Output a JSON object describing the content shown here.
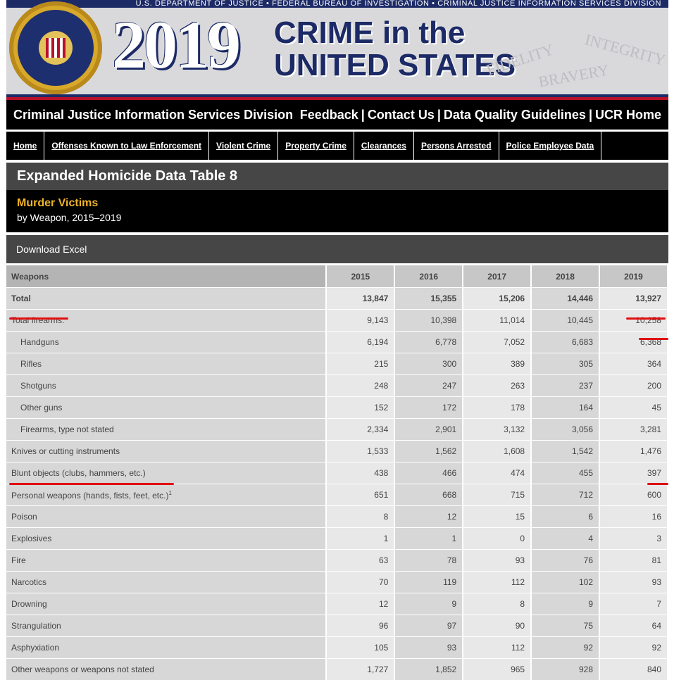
{
  "banner": {
    "top_strip": "U.S. DEPARTMENT OF JUSTICE • FEDERAL BUREAU OF INVESTIGATION • CRIMINAL JUSTICE INFORMATION SERVICES DIVISION",
    "year": "2019",
    "title_line1": "CRIME in the",
    "title_line2": "UNITED STATES",
    "motto": [
      "FIDELITY",
      "BRAVERY",
      "INTEGRITY"
    ]
  },
  "nav_primary": {
    "division": "Criminal Justice Information Services Division",
    "links": [
      "Feedback",
      "Contact Us",
      "Data Quality Guidelines",
      "UCR Home"
    ],
    "separator": "|"
  },
  "nav_secondary": [
    "Home",
    "Offenses Known to Law Enforcement",
    "Violent Crime",
    "Property Crime",
    "Clearances",
    "Persons Arrested",
    "Police Employee Data"
  ],
  "page": {
    "title": "Expanded Homicide Data Table 8",
    "subtitle": "Murder Victims",
    "subtitle2": "by Weapon, 2015–2019",
    "download": "Download Excel"
  },
  "table": {
    "headers": [
      "Weapons",
      "2015",
      "2016",
      "2017",
      "2018",
      "2019"
    ],
    "rows": [
      {
        "label": "Total",
        "values": [
          "13,847",
          "15,355",
          "15,206",
          "14,446",
          "13,927"
        ]
      },
      {
        "label": "Total firearms:",
        "values": [
          "9,143",
          "10,398",
          "11,014",
          "10,445",
          "10,258"
        ]
      },
      {
        "label": "Handguns",
        "values": [
          "6,194",
          "6,778",
          "7,052",
          "6,683",
          "6,368"
        ]
      },
      {
        "label": "Rifles",
        "values": [
          "215",
          "300",
          "389",
          "305",
          "364"
        ]
      },
      {
        "label": "Shotguns",
        "values": [
          "248",
          "247",
          "263",
          "237",
          "200"
        ]
      },
      {
        "label": "Other guns",
        "values": [
          "152",
          "172",
          "178",
          "164",
          "45"
        ]
      },
      {
        "label": "Firearms, type not stated",
        "values": [
          "2,334",
          "2,901",
          "3,132",
          "3,056",
          "3,281"
        ]
      },
      {
        "label": "Knives or cutting instruments",
        "values": [
          "1,533",
          "1,562",
          "1,608",
          "1,542",
          "1,476"
        ]
      },
      {
        "label": "Blunt objects (clubs, hammers, etc.)",
        "values": [
          "438",
          "466",
          "474",
          "455",
          "397"
        ]
      },
      {
        "label": "Personal weapons (hands, fists, feet, etc.)",
        "sup": "1",
        "values": [
          "651",
          "668",
          "715",
          "712",
          "600"
        ]
      },
      {
        "label": "Poison",
        "values": [
          "8",
          "12",
          "15",
          "6",
          "16"
        ]
      },
      {
        "label": "Explosives",
        "values": [
          "1",
          "1",
          "0",
          "4",
          "3"
        ]
      },
      {
        "label": "Fire",
        "values": [
          "63",
          "78",
          "93",
          "76",
          "81"
        ]
      },
      {
        "label": "Narcotics",
        "values": [
          "70",
          "119",
          "112",
          "102",
          "93"
        ]
      },
      {
        "label": "Drowning",
        "values": [
          "12",
          "9",
          "8",
          "9",
          "7"
        ]
      },
      {
        "label": "Strangulation",
        "values": [
          "96",
          "97",
          "90",
          "75",
          "64"
        ]
      },
      {
        "label": "Asphyxiation",
        "values": [
          "105",
          "93",
          "112",
          "92",
          "92"
        ]
      },
      {
        "label": "Other weapons or weapons not stated",
        "values": [
          "1,727",
          "1,852",
          "965",
          "928",
          "840"
        ]
      }
    ]
  },
  "annotation_color": "#e01010"
}
